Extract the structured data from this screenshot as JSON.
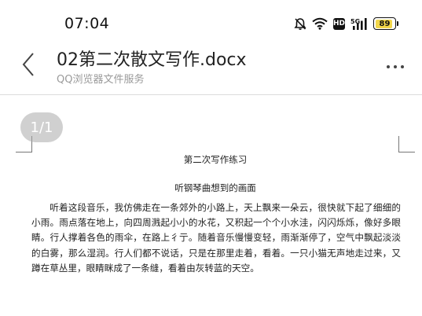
{
  "status_bar": {
    "time": "07:04",
    "battery_level": 89,
    "battery_label": "89",
    "icons": [
      "mute-bell-icon",
      "wifi-icon",
      "hd-icon",
      "5g-signal-icon",
      "battery-icon"
    ],
    "hd_label": "HD",
    "net_label": "5G"
  },
  "header": {
    "title": "02第二次散文写作.docx",
    "subtitle": "QQ浏览器文件服务",
    "back_icon": "chevron-left-icon",
    "more_icon": "more-horizontal-icon"
  },
  "document": {
    "page_indicator": "1/1",
    "heading": "第二次写作练习",
    "subheading": "听钢琴曲想到的画面",
    "paragraph": "听着这段音乐，我仿佛走在一条郊外的小路上，天上飘来一朵云，很快就下起了细细的小雨。雨点落在地上，向四周溅起小小的水花，又积起一个个小水洼，闪闪烁烁，像好多眼睛。行人撑着各色的雨伞，在路上彳亍。随着音乐慢慢变轻，雨渐渐停了，空气中飘起淡淡的白雾，那么湿润。行人们都不说话，只是在那里走着，看着。一只小猫无声地走过来，又蹲在草丛里，眼睛眯成了一条缝，看着由灰转蓝的天空。"
  },
  "colors": {
    "battery_fill": "#f2d64a",
    "page_indicator_bg": "#aaaaaa",
    "subtitle": "#9a9a9a"
  }
}
